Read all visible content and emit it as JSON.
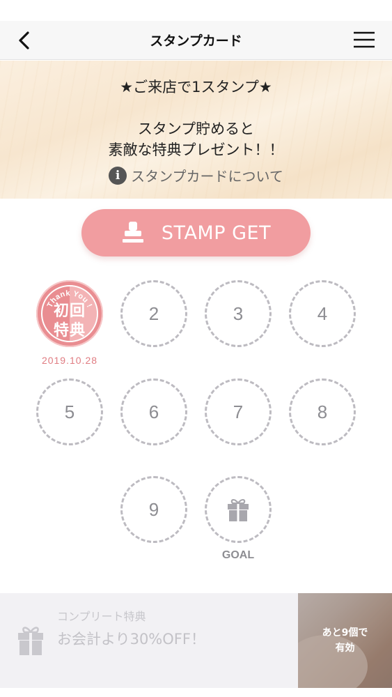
{
  "header": {
    "title": "スタンプカード",
    "back_icon": "chevron-left-icon",
    "menu_icon": "hamburger-menu-icon"
  },
  "banner": {
    "headline": "★ご来店で1スタンプ★",
    "message_line1": "スタンプ貯めると",
    "message_line2": "素敵な特典プレゼント！！",
    "info_link": "スタンプカードについて",
    "info_icon": "info-icon"
  },
  "stamp_button": {
    "label": "STAMP GET",
    "icon": "stamp-icon",
    "color": "#f19da0"
  },
  "card": {
    "first_stamp": {
      "badge_top": "Thank You !",
      "line1": "初回",
      "line2": "特典",
      "date": "2019.10.28",
      "color": "#e98d91"
    },
    "slots": [
      "2",
      "3",
      "4",
      "5",
      "6",
      "7",
      "8",
      "9"
    ],
    "goal": {
      "label": "GOAL",
      "icon": "gift-icon"
    }
  },
  "footer": {
    "label": "コンプリート特典",
    "value": "お会計より30%OFF！",
    "remaining_line1": "あと9個で",
    "remaining_line2": "有効",
    "icon": "gift-icon"
  }
}
